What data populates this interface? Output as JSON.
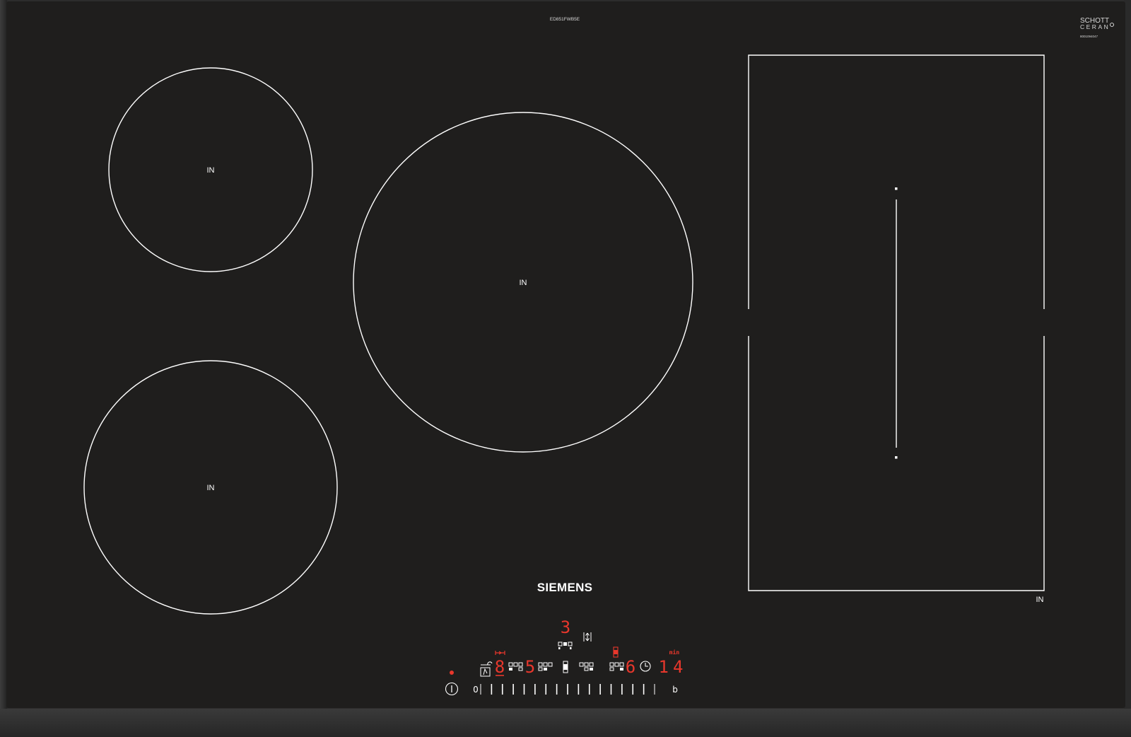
{
  "model_code": "ED851FWB5E",
  "glass_brand": {
    "line1": "SCHOTT",
    "line2": "CERAN",
    "code": "8001094047"
  },
  "brand": "SIEMENS",
  "zones": [
    {
      "label": "IN"
    },
    {
      "label": "IN"
    },
    {
      "label": "IN"
    },
    {
      "label": "IN"
    }
  ],
  "control_panel": {
    "displays": {
      "top": "3",
      "left_zone": "8",
      "middle_zone": "5",
      "right_zone": "6",
      "timer": "14",
      "timer_unit": "min"
    },
    "slider": {
      "min_label": "0",
      "max_label": "b",
      "segments": 17
    },
    "power_icon": "power-icon",
    "timer_icon": "clock-icon",
    "wipe_lock_icon": "wipe-lock-icon",
    "colors": {
      "indicator": "#e8372c",
      "glass": "#1f1e1d",
      "frame": "#333333"
    }
  }
}
